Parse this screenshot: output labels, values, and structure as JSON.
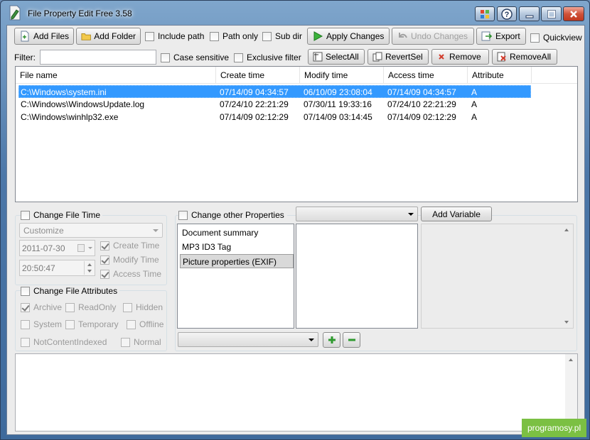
{
  "window": {
    "title": "File Property Edit Free 3.58"
  },
  "toolbar": {
    "add_files": "Add Files",
    "add_folder": "Add Folder",
    "include_path": "Include path",
    "path_only": "Path only",
    "sub_dir": "Sub dir",
    "apply_changes": "Apply Changes",
    "undo_changes": "Undo Changes",
    "export": "Export",
    "quickview": "Quickview"
  },
  "filter_bar": {
    "label": "Filter:",
    "value": "",
    "case_sensitive": "Case sensitive",
    "exclusive_filter": "Exclusive filter",
    "select_all": "SelectAll",
    "revert_sel": "RevertSel",
    "remove": "Remove",
    "remove_all": "RemoveAll"
  },
  "file_list": {
    "columns": [
      "File name",
      "Create time",
      "Modify time",
      "Access time",
      "Attribute"
    ],
    "rows": [
      [
        "C:\\Windows\\system.ini",
        "07/14/09 04:34:57",
        "06/10/09 23:08:04",
        "07/14/09 04:34:57",
        "A"
      ],
      [
        "C:\\Windows\\WindowsUpdate.log",
        "07/24/10 22:21:29",
        "07/30/11 19:33:16",
        "07/24/10 22:21:29",
        "A"
      ],
      [
        "C:\\Windows\\winhlp32.exe",
        "07/14/09 02:12:29",
        "07/14/09 03:14:45",
        "07/14/09 02:12:29",
        "A"
      ]
    ]
  },
  "file_time": {
    "label": "Change File Time",
    "mode": "Customize",
    "date": "2011-07-30",
    "time": "20:50:47",
    "create_time": "Create Time",
    "modify_time": "Modify Time",
    "access_time": "Access Time"
  },
  "file_attributes": {
    "label": "Change File Attributes",
    "archive": "Archive",
    "readonly": "ReadOnly",
    "hidden": "Hidden",
    "system": "System",
    "temporary": "Temporary",
    "offline": "Offline",
    "not_content_indexed": "NotContentIndexed",
    "normal": "Normal"
  },
  "other_properties": {
    "label": "Change other Properties",
    "add_variable": "Add Variable",
    "categories": [
      "Document summary",
      "MP3 ID3 Tag",
      "Picture properties (EXIF)"
    ]
  },
  "watermark": "programosy.pl"
}
